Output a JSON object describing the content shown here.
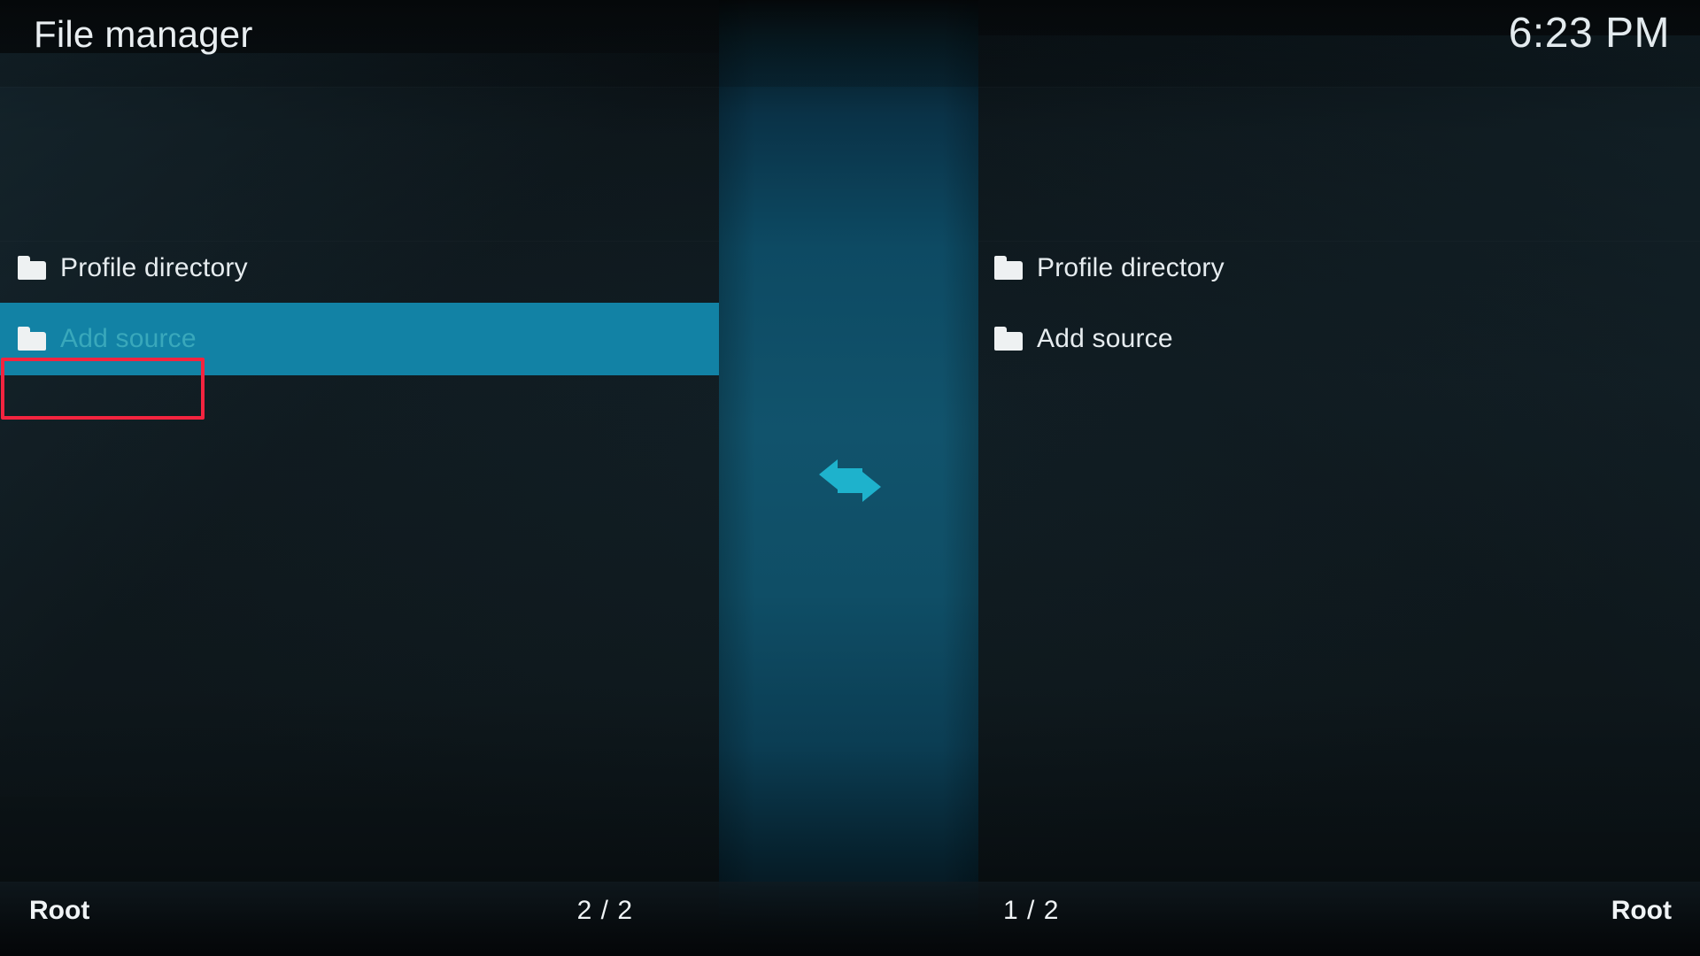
{
  "window": {
    "title": "File manager",
    "clock": "6:23 PM"
  },
  "colors": {
    "background": "#0c1317",
    "highlight": "#1282a5",
    "selected_text": "#39a8bb",
    "center_panel": "#11536c",
    "swap_arrow": "#1eb2cc",
    "focus_outline": "#f4243f",
    "text": "#e6ecef"
  },
  "left_pane": {
    "items": [
      {
        "icon": "folder-icon",
        "label": "Profile directory",
        "selected": false
      },
      {
        "icon": "folder-icon",
        "label": "Add source",
        "selected": true
      }
    ],
    "footer": {
      "path": "Root",
      "page": "2 / 2"
    }
  },
  "center": {
    "icon": "swap-arrows-icon"
  },
  "right_pane": {
    "items": [
      {
        "icon": "folder-icon",
        "label": "Profile directory",
        "selected": false
      },
      {
        "icon": "folder-icon",
        "label": "Add source",
        "selected": false
      }
    ],
    "footer": {
      "path": "Root",
      "page": "1 / 2"
    }
  },
  "annotation": {
    "focus_target": "Add source"
  }
}
